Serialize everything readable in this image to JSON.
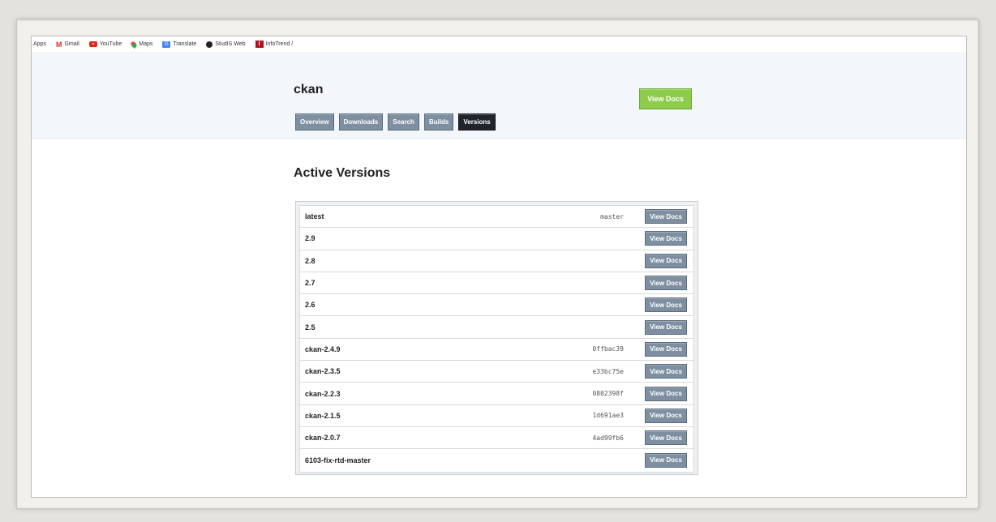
{
  "bookmarks": [
    {
      "label": "Apps",
      "icon": ""
    },
    {
      "label": "Gmail",
      "icon": "gmail-icon"
    },
    {
      "label": "YouTube",
      "icon": "youtube-icon"
    },
    {
      "label": "Maps",
      "icon": "maps-icon"
    },
    {
      "label": "Translate",
      "icon": "translate-icon"
    },
    {
      "label": "StudIS Web",
      "icon": "studis-icon"
    },
    {
      "label": "InfoTrend /",
      "icon": "infotrend-icon"
    }
  ],
  "header": {
    "project": "ckan",
    "view_docs": "View Docs",
    "nav": [
      "Overview",
      "Downloads",
      "Search",
      "Builds",
      "Versions"
    ],
    "active_nav": "Versions"
  },
  "main": {
    "section_title": "Active Versions",
    "button_label": "View Docs",
    "versions": [
      {
        "name": "latest",
        "ref": "master"
      },
      {
        "name": "2.9",
        "ref": ""
      },
      {
        "name": "2.8",
        "ref": ""
      },
      {
        "name": "2.7",
        "ref": ""
      },
      {
        "name": "2.6",
        "ref": ""
      },
      {
        "name": "2.5",
        "ref": ""
      },
      {
        "name": "ckan-2.4.9",
        "ref": "0ffbac39"
      },
      {
        "name": "ckan-2.3.5",
        "ref": "e33bc75e"
      },
      {
        "name": "ckan-2.2.3",
        "ref": "0802398f"
      },
      {
        "name": "ckan-2.1.5",
        "ref": "1d691ae3"
      },
      {
        "name": "ckan-2.0.7",
        "ref": "4ad99fb6"
      },
      {
        "name": "6103-fix-rtd-master",
        "ref": ""
      }
    ]
  },
  "colors": {
    "primary_button": "#8dcb4a",
    "secondary_button": "#7d8fa0",
    "active_tab": "#1f252b"
  }
}
